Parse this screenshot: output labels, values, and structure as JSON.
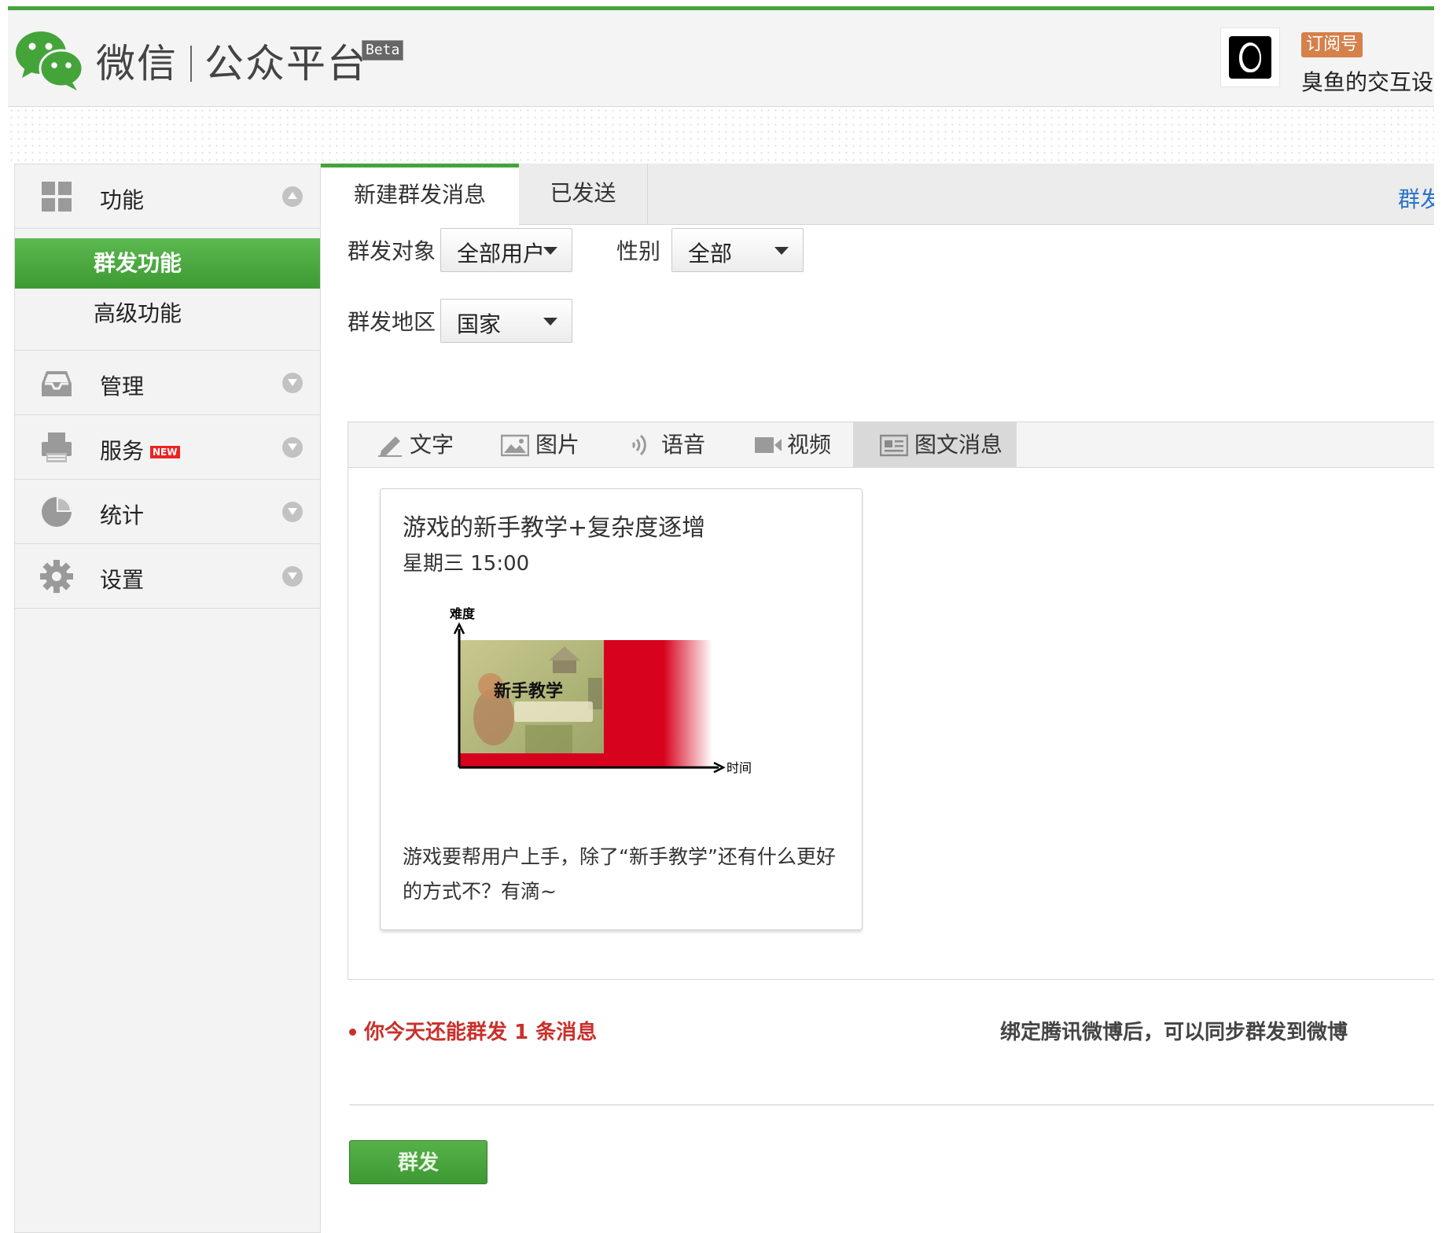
{
  "header": {
    "brand_main": "微信",
    "brand_sub": "公众平台",
    "beta": "Beta",
    "account_type": "订阅号",
    "account_name": "臭鱼的交互设计"
  },
  "sidebar": {
    "sections": [
      {
        "label": "功能",
        "icon": "grid-icon",
        "expanded": true,
        "items": [
          {
            "label": "群发功能",
            "active": true
          },
          {
            "label": "高级功能",
            "active": false
          }
        ]
      },
      {
        "label": "管理",
        "icon": "inbox-icon",
        "expanded": false
      },
      {
        "label": "服务",
        "icon": "printer-icon",
        "expanded": false,
        "badge": "NEW"
      },
      {
        "label": "统计",
        "icon": "pie-icon",
        "expanded": false
      },
      {
        "label": "设置",
        "icon": "gear-icon",
        "expanded": false
      }
    ]
  },
  "tabs": {
    "new_message": "新建群发消息",
    "sent": "已发送",
    "right_link": "群发"
  },
  "form": {
    "target_label": "群发对象",
    "target_value": "全部用户",
    "gender_label": "性别",
    "gender_value": "全部",
    "region_label": "群发地区",
    "region_value": "国家"
  },
  "editor": {
    "tools": [
      {
        "label": "文字",
        "icon": "pencil-icon"
      },
      {
        "label": "图片",
        "icon": "image-icon"
      },
      {
        "label": "语音",
        "icon": "sound-icon"
      },
      {
        "label": "视频",
        "icon": "video-icon"
      },
      {
        "label": "图文消息",
        "icon": "news-icon",
        "active": true
      }
    ]
  },
  "card": {
    "title": "游戏的新手教学+复杂度逐增",
    "time": "星期三 15:00",
    "cover": {
      "y_axis": "难度",
      "x_axis": "时间",
      "label": "新手教学"
    },
    "description": "游戏要帮用户上手，除了“新手教学”还有什么更好的方式不？有滴~"
  },
  "footer": {
    "quota": "你今天还能群发 1 条消息",
    "bind_note": "绑定腾讯微博后，可以同步群发到微博",
    "send_button": "群发"
  },
  "colors": {
    "brand_green": "#44a43a",
    "link_blue": "#2a74c7",
    "alert_red": "#c9302c",
    "badge_orange": "#d6804a"
  }
}
